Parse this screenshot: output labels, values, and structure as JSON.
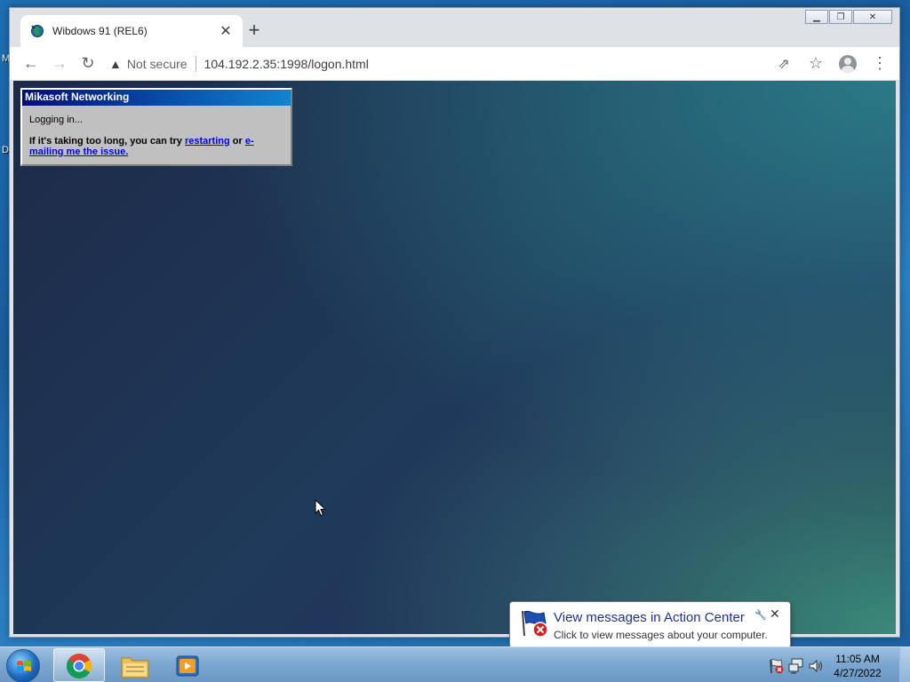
{
  "desktop": {
    "fragments": [
      "M",
      "D"
    ]
  },
  "browser": {
    "tab": {
      "title": "Wibdows 91 (REL6)",
      "close_glyph": "✕"
    },
    "newtab_glyph": "+",
    "window_buttons": {
      "minimize": "▁",
      "restore": "❐",
      "close": "✕"
    },
    "toolbar": {
      "back_glyph": "←",
      "forward_glyph": "→",
      "reload_glyph": "↻",
      "security_glyph": "▲",
      "security_text": "Not secure",
      "url": "104.192.2.35:1998/logon.html",
      "share_glyph": "⇗",
      "star_glyph": "☆",
      "menu_glyph": "⋮"
    }
  },
  "dialog": {
    "title": "Mikasoft Networking",
    "status": "Logging in...",
    "help_prefix": "If it's taking too long, you can try ",
    "restart_link": "restarting",
    "help_middle": " or ",
    "email_link": "e-mailing me the issue."
  },
  "notification": {
    "title": "View messages in Action Center",
    "subtitle": "Click to view messages about your computer.",
    "pin_glyph": "🔧",
    "close_glyph": "✕"
  },
  "taskbar": {
    "apps": [
      {
        "name": "chrome-taskbar-button",
        "active": true
      },
      {
        "name": "explorer-taskbar-button",
        "active": false
      },
      {
        "name": "media-player-taskbar-button",
        "active": false
      }
    ],
    "clock": {
      "time": "11:05 AM",
      "date": "4/27/2022"
    }
  },
  "colors": {
    "dialog_title_bg": "#000c7c",
    "link": "#0000ee",
    "notification_title": "#1e3287"
  }
}
